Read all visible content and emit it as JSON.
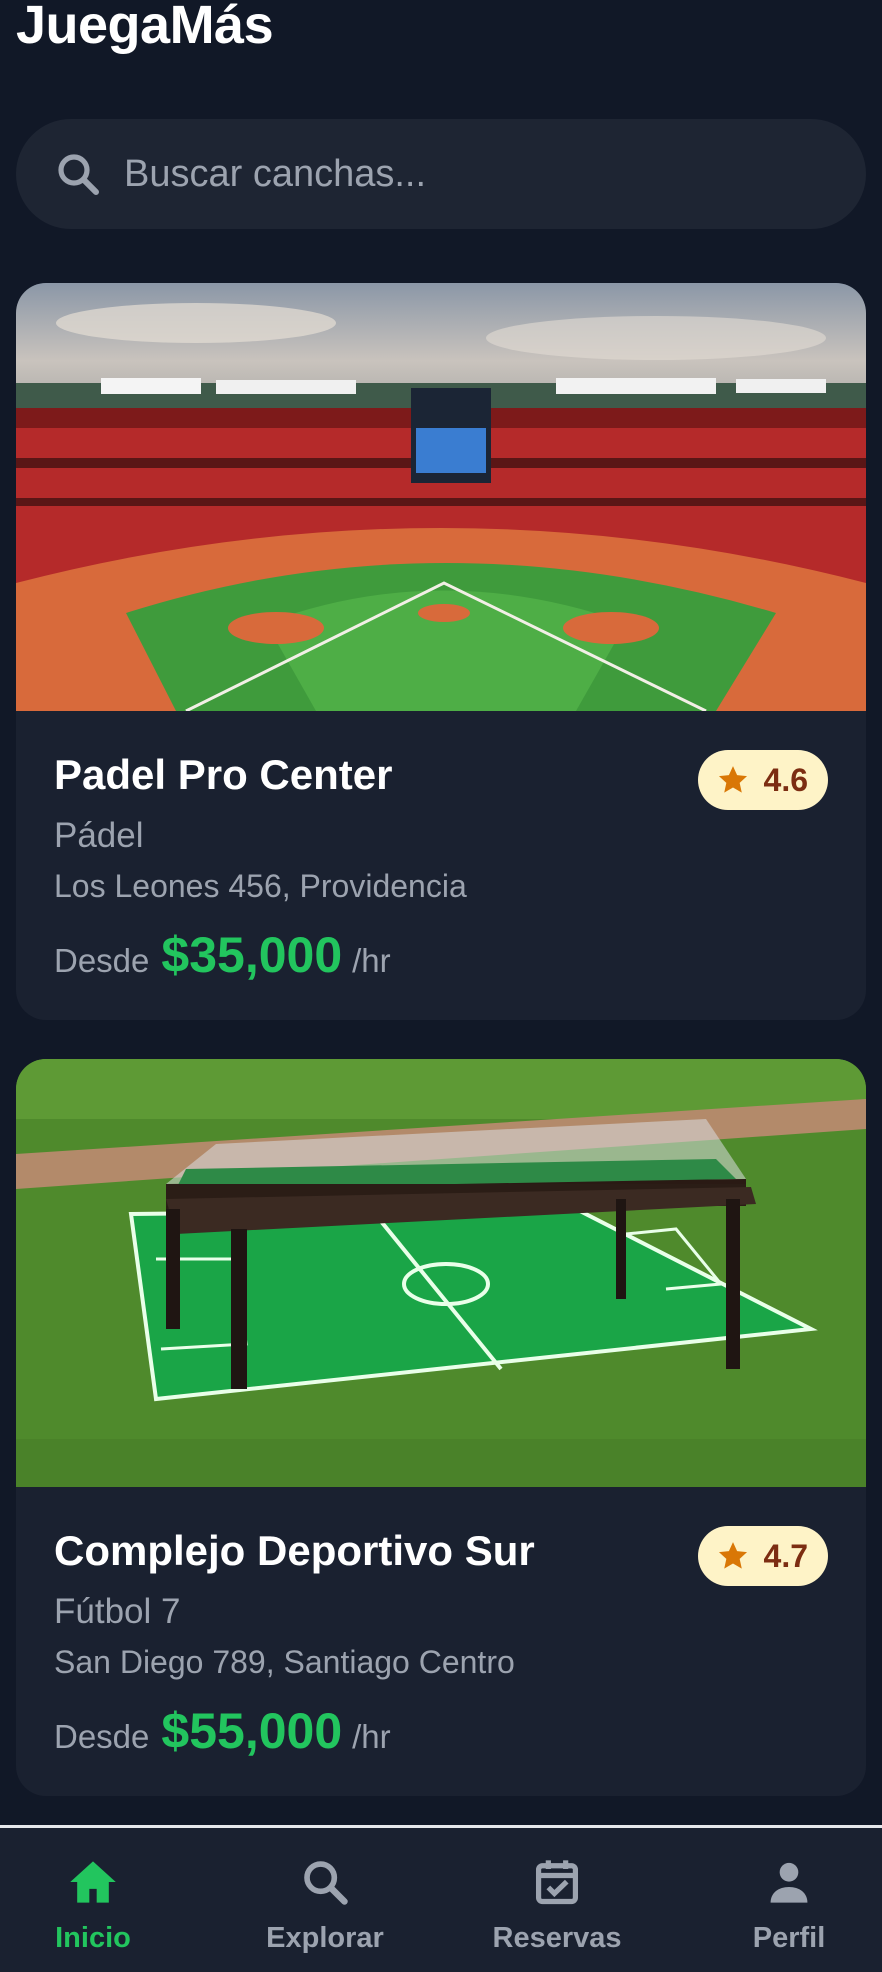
{
  "app": {
    "title": "JuegaMás"
  },
  "search": {
    "placeholder": "Buscar canchas..."
  },
  "venues": [
    {
      "image": "baseball-stadium-photo",
      "name": "Padel Pro Center",
      "sport": "Pádel",
      "address": "Los Leones 456, Providencia",
      "price_prefix": "Desde",
      "price": "$35,000",
      "price_unit": "/hr",
      "rating": "4.6"
    },
    {
      "image": "foosball-table-on-grass-photo",
      "name": "Complejo Deportivo Sur",
      "sport": "Fútbol 7",
      "address": "San Diego 789, Santiago Centro",
      "price_prefix": "Desde",
      "price": "$55,000",
      "price_unit": "/hr",
      "rating": "4.7"
    }
  ],
  "tabbar": {
    "items": [
      {
        "label": "Inicio",
        "icon": "home-icon",
        "active": true
      },
      {
        "label": "Explorar",
        "icon": "search-icon",
        "active": false
      },
      {
        "label": "Reservas",
        "icon": "calendar-check-icon",
        "active": false
      },
      {
        "label": "Perfil",
        "icon": "person-icon",
        "active": false
      }
    ]
  },
  "colors": {
    "background": "#111827",
    "card": "#1a2130",
    "accent": "#22c55e",
    "rating_bg": "#fef3c7",
    "rating_star": "#d97706",
    "muted_text": "#9ca3af"
  }
}
